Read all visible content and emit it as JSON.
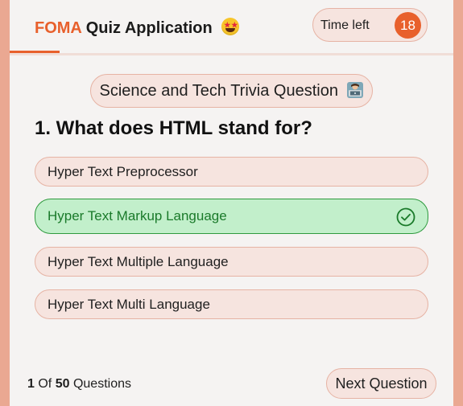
{
  "header": {
    "brand": "FOMA",
    "title": "Quiz Application",
    "emoji_icon": "star-struck-face-icon"
  },
  "timer": {
    "label": "Time left",
    "seconds": "18"
  },
  "category": {
    "label": "Science and Tech Trivia Question",
    "icon": "technologist-laptop-icon"
  },
  "question": {
    "text": "1. What does HTML stand for?"
  },
  "options": [
    {
      "label": "Hyper Text Preprocessor",
      "state": "default"
    },
    {
      "label": "Hyper Text Markup Language",
      "state": "correct"
    },
    {
      "label": "Hyper Text Multiple Language",
      "state": "default"
    },
    {
      "label": "Hyper Text Multi Language",
      "state": "default"
    }
  ],
  "footer": {
    "current": "1",
    "of_label": "Of",
    "total": "50",
    "questions_label": "Questions",
    "next_label": "Next Question"
  },
  "colors": {
    "accent": "#e8602c",
    "background": "#eaa892",
    "option_bg": "#f6e4df",
    "correct_bg": "#c2efcb",
    "correct_border": "#2e9a3e"
  }
}
